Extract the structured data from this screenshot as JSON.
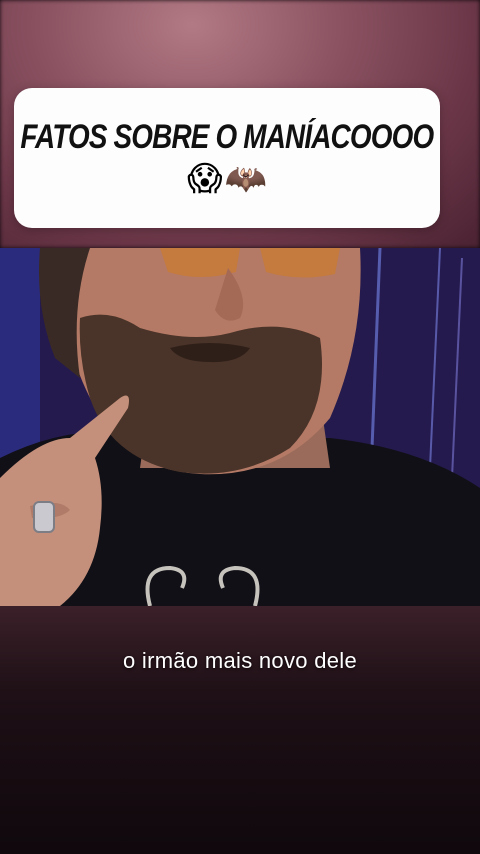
{
  "title_card": {
    "title": "FATOS SOBRE O MANÍACOOOO",
    "emoji_1": "😱",
    "emoji_2": "🦇"
  },
  "video": {
    "subtitle": "o irmão mais novo dele"
  },
  "colors": {
    "card_bg": "#fdfdfd",
    "title_text": "#111111",
    "subtitle_text": "#ffffff"
  }
}
